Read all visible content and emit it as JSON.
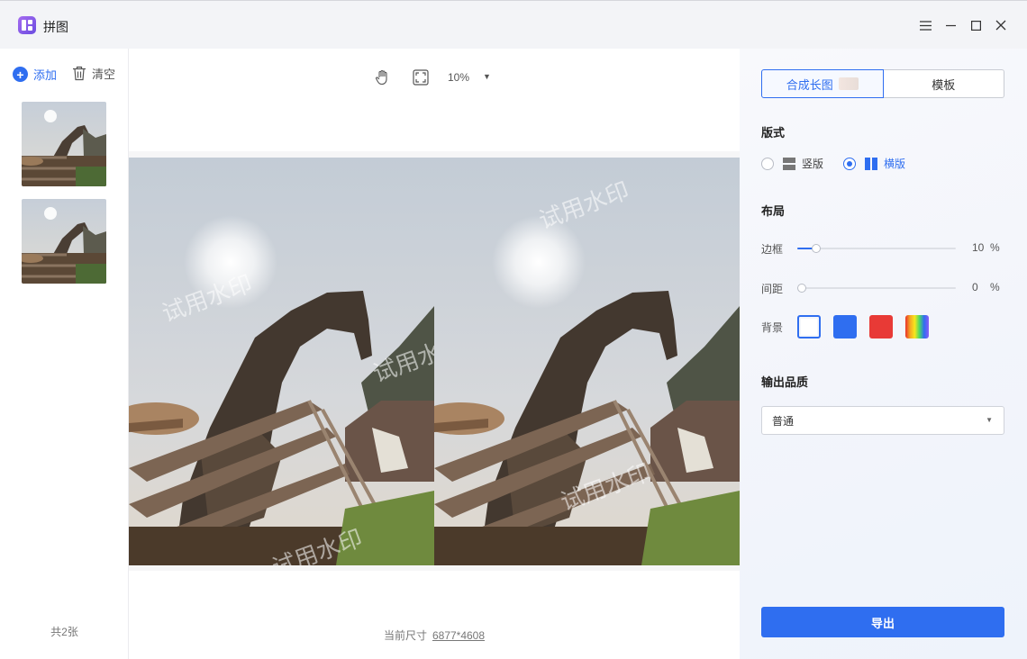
{
  "app": {
    "title": "拼图"
  },
  "window_controls": {
    "menu_icon": "hamburger-icon",
    "minimize_icon": "minimize-icon",
    "maximize_icon": "maximize-icon",
    "close_icon": "close-icon"
  },
  "left_panel": {
    "add_label": "添加",
    "clear_label": "清空",
    "images": [
      {
        "alt": "giraffe-photo-thumbnail"
      },
      {
        "alt": "giraffe-photo-thumbnail"
      }
    ],
    "count_label": "共2张"
  },
  "canvas": {
    "zoom": "10%",
    "watermark": "试用水印",
    "size_prefix": "当前尺寸",
    "size_value": "6877*4608"
  },
  "right_panel": {
    "tabs": [
      {
        "label": "合成长图",
        "active": true
      },
      {
        "label": "模板",
        "active": false
      }
    ],
    "layout_title": "版式",
    "layout_options": [
      {
        "label": "竖版",
        "checked": false
      },
      {
        "label": "横版",
        "checked": true
      }
    ],
    "arrangement_title": "布局",
    "border": {
      "label": "边框",
      "value": "10",
      "unit": "%"
    },
    "spacing": {
      "label": "间距",
      "value": "0",
      "unit": "%"
    },
    "background": {
      "label": "背景",
      "colors": [
        "#ffffff",
        "#2f6ef0",
        "#e83a36",
        "rainbow"
      ],
      "selected": "#ffffff"
    },
    "quality_title": "输出品质",
    "quality_value": "普通",
    "export_label": "导出"
  },
  "colors": {
    "accent": "#2f6ef0"
  }
}
